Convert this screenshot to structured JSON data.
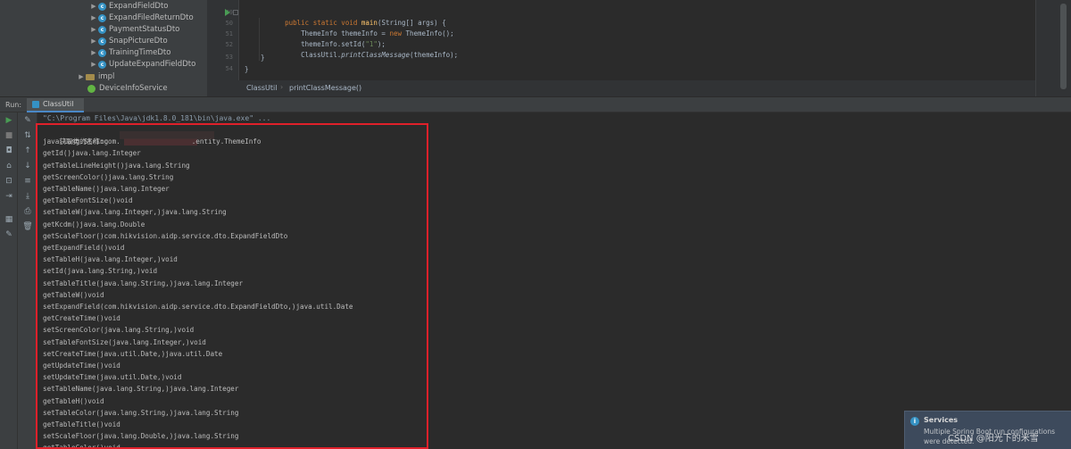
{
  "project_tree": {
    "items": [
      {
        "label": "ExpandFieldDto",
        "kind": "class"
      },
      {
        "label": "ExpandFiledReturnDto",
        "kind": "class"
      },
      {
        "label": "PaymentStatusDto",
        "kind": "class"
      },
      {
        "label": "SnapPictureDto",
        "kind": "class"
      },
      {
        "label": "TrainingTimeDto",
        "kind": "class"
      },
      {
        "label": "UpdateExpandFieldDto",
        "kind": "class"
      },
      {
        "label": "impl",
        "kind": "package"
      },
      {
        "label": "DeviceInfoService",
        "kind": "service"
      }
    ]
  },
  "editor": {
    "line_numbers": [
      "49",
      "50",
      "51",
      "52",
      "53",
      "54"
    ],
    "code": {
      "l1_kw": "public static void ",
      "l1_fn": "main",
      "l1_rest": "(String[] args) {",
      "l2_a": "ThemeInfo themeInfo = ",
      "l2_kw": "new ",
      "l2_b": "ThemeInfo();",
      "l3_a": "themeInfo.setId(",
      "l3_str": "\"1\"",
      "l3_b": ");",
      "l4_a": "ClassUtil.",
      "l4_it": "printClassMessage",
      "l4_b": "(themeInfo);",
      "l5": "}",
      "l6": "}"
    }
  },
  "breadcrumb": {
    "class_name": "ClassUtil",
    "method_name": "printClassMessage()"
  },
  "run_panel": {
    "label": "Run:",
    "tab_label": "ClassUtil",
    "command": "\"C:\\Program Files\\Java\\jdk1.8.0_181\\bin\\java.exe\" ..."
  },
  "console_output": {
    "first_line_prefix": "获取类的名称:com.",
    "first_line_suffix": ".entity.ThemeInfo",
    "lines": [
      "java.lang.String",
      "getId()java.lang.Integer",
      "getTableLineHeight()java.lang.String",
      "getScreenColor()java.lang.String",
      "getTableName()java.lang.Integer",
      "getTableFontSize()void",
      "setTableW(java.lang.Integer,)java.lang.String",
      "getKcdm()java.lang.Double",
      "getScaleFloor()com.hikvision.aidp.service.dto.ExpandFieldDto",
      "getExpandField()void",
      "setTableH(java.lang.Integer,)void",
      "setId(java.lang.String,)void",
      "setTableTitle(java.lang.String,)java.lang.Integer",
      "getTableW()void",
      "setExpandField(com.hikvision.aidp.service.dto.ExpandFieldDto,)java.util.Date",
      "getCreateTime()void",
      "setScreenColor(java.lang.String,)void",
      "setTableFontSize(java.lang.Integer,)void",
      "setCreateTime(java.util.Date,)java.util.Date",
      "getUpdateTime()void",
      "setUpdateTime(java.util.Date,)void",
      "setTableName(java.lang.String,)java.lang.Integer",
      "getTableH()void",
      "setTableColor(java.lang.String,)java.lang.String",
      "getTableTitle()void",
      "setScaleFloor(java.lang.Double,)java.lang.String",
      "getTableColor()void"
    ]
  },
  "services_popup": {
    "title": "Services",
    "message": "Multiple Spring Boot run configurations were detected."
  },
  "watermark": "CSDN @阳光下的米雪",
  "colors": {
    "highlight_border": "#e0202a",
    "editor_bg": "#2b2b2b",
    "panel_bg": "#3c3f41"
  }
}
